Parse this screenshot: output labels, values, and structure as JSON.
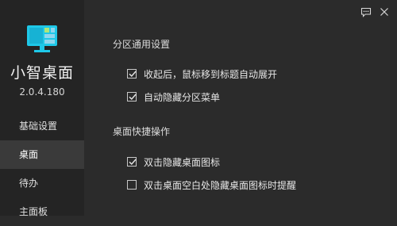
{
  "app": {
    "name": "小智桌面",
    "version": "2.0.4.180"
  },
  "sidebar": {
    "items": [
      {
        "label": "基础设置",
        "active": false
      },
      {
        "label": "桌面",
        "active": true
      },
      {
        "label": "待办",
        "active": false
      },
      {
        "label": "主面板",
        "active": false
      }
    ]
  },
  "top_icons": [
    "feedback-icon",
    "close-icon"
  ],
  "sections": [
    {
      "title": "分区通用设置",
      "options": [
        {
          "label": "收起后，鼠标移到标题自动展开",
          "checked": true
        },
        {
          "label": "自动隐藏分区菜单",
          "checked": true
        }
      ]
    },
    {
      "title": "桌面快捷操作",
      "options": [
        {
          "label": "双击隐藏桌面图标",
          "checked": true
        },
        {
          "label": "双击桌面空白处隐藏桌面图标时提醒",
          "checked": false
        }
      ]
    }
  ],
  "colors": {
    "background": "#2b2b2b",
    "sidebar": "#242424",
    "sidebar_active": "#3a3a3a",
    "logo_accent": "#1ec8e8",
    "logo_light": "#aee67a"
  }
}
